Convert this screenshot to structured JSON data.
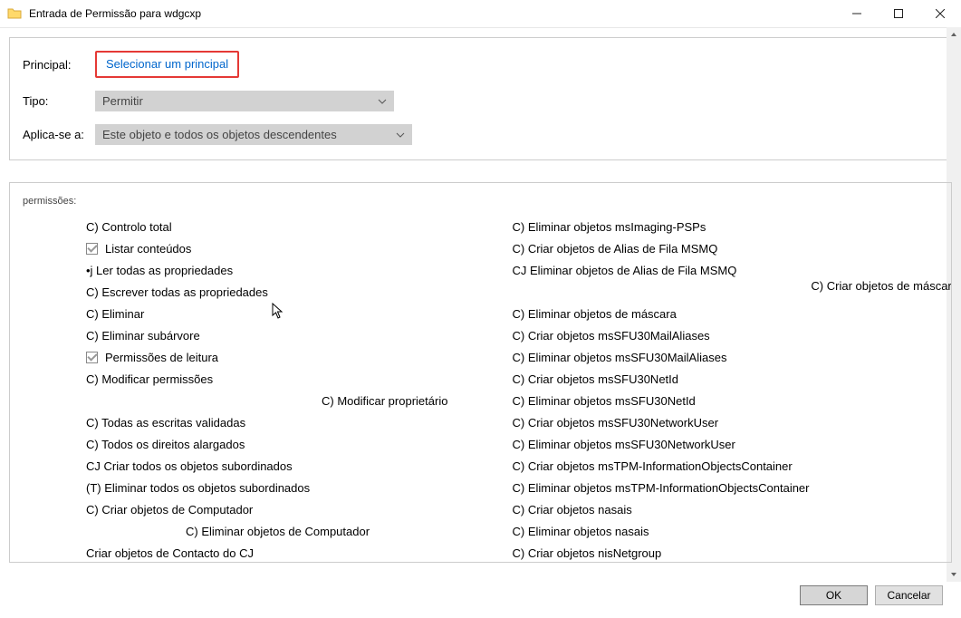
{
  "window": {
    "title": "Entrada de Permissão para wdgcxp"
  },
  "form": {
    "principal_label": "Principal:",
    "principal_link": "Selecionar um principal",
    "type_label": "Tipo:",
    "type_value": "Permitir",
    "applies_label": "Aplica-se a:",
    "applies_value": "Este objeto e todos os objetos descendentes"
  },
  "permissions_heading": "permissões:",
  "perms_left": [
    {
      "prefix": "C)",
      "label": "Controlo total"
    },
    {
      "checked": true,
      "label": "Listar conteúdos"
    },
    {
      "prefix": "•j",
      "label": "Ler todas as propriedades"
    },
    {
      "prefix": "C)",
      "label": "Escrever todas as propriedades"
    },
    {
      "prefix": "C)",
      "label": "Eliminar"
    },
    {
      "prefix": "C)",
      "label": "Eliminar subárvore"
    },
    {
      "checked": true,
      "label": "Permissões de leitura"
    },
    {
      "prefix": "C)",
      "label": "Modificar permissões"
    },
    {
      "prefix": "C)",
      "label": "Modificar proprietário",
      "offset": 1
    },
    {
      "prefix": "C)",
      "label": "Todas as escritas validadas"
    },
    {
      "prefix": "C)",
      "label": "Todos os direitos alargados"
    },
    {
      "prefix": "CJ",
      "label": "Criar todos os objetos subordinados"
    },
    {
      "prefix": "(T)",
      "label": "Eliminar todos os objetos subordinados"
    },
    {
      "prefix": "C)",
      "label": "Criar objetos de Computador"
    },
    {
      "prefix": "C)",
      "label": "Eliminar objetos de Computador",
      "offset": 2
    },
    {
      "prefix": "",
      "label": "Criar objetos de Contacto do CJ"
    }
  ],
  "perms_right": [
    {
      "prefix": "C)",
      "label": "Eliminar objetos msImaging-PSPs"
    },
    {
      "prefix": "C)",
      "label": "Criar objetos de Alias de Fila MSMQ"
    },
    {
      "prefix": "CJ",
      "label": "Eliminar objetos de Alias de Fila MSMQ"
    },
    {
      "prefix": "",
      "label": ""
    },
    {
      "prefix": "C)",
      "label": "Eliminar objetos de máscara"
    },
    {
      "prefix": "C)",
      "label": "Criar objetos msSFU30MailAliases"
    },
    {
      "prefix": "C)",
      "label": "Eliminar objetos msSFU30MailAliases"
    },
    {
      "prefix": "C)",
      "label": "Criar objetos msSFU30NetId"
    },
    {
      "prefix": "C)",
      "label": "Eliminar objetos msSFU30NetId"
    },
    {
      "prefix": "C)",
      "label": "Criar objetos msSFU30NetworkUser"
    },
    {
      "prefix": "C)",
      "label": "Eliminar objetos msSFU30NetworkUser"
    },
    {
      "prefix": "C)",
      "label": "Criar objetos msTPM-InformationObjectsContainer"
    },
    {
      "prefix": "C)",
      "label": "Eliminar objetos msTPM-InformationObjectsContainer"
    },
    {
      "prefix": "C)",
      "label": "Criar objetos nasais"
    },
    {
      "prefix": "C)",
      "label": "Eliminar objetos nasais"
    },
    {
      "prefix": "C)",
      "label": "Criar objetos nisNetgroup"
    }
  ],
  "overflow_item": {
    "prefix": "C)",
    "label": "Criar objetos de máscara"
  },
  "buttons": {
    "ok": "OK",
    "cancel": "Cancelar"
  }
}
